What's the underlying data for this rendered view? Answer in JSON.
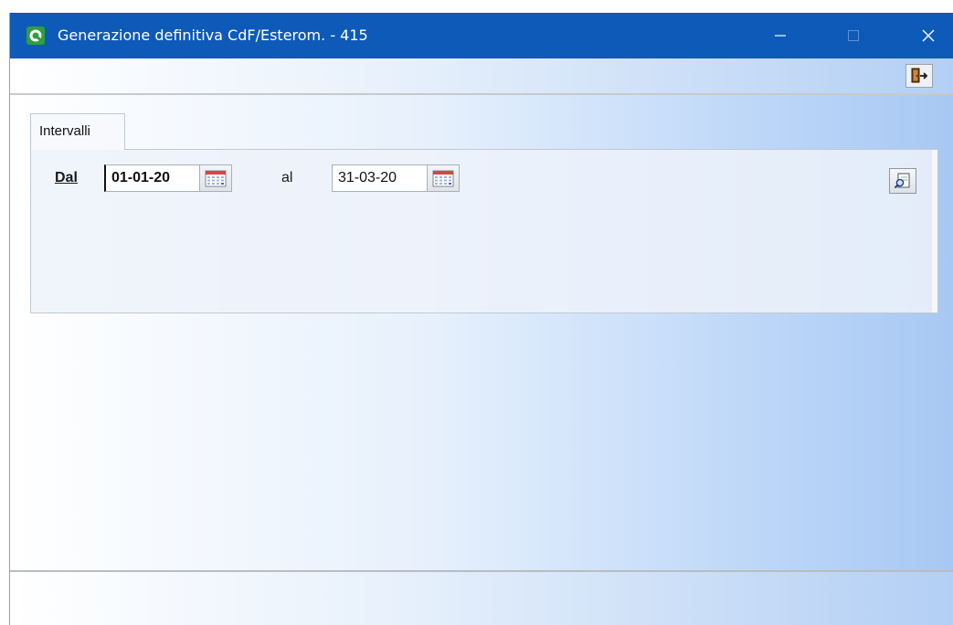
{
  "window": {
    "title": "Generazione definitiva CdF/Esterom. - 415",
    "app_icon": "app-logo-icon",
    "controls": {
      "minimize": "—",
      "maximize": "☐",
      "close": "✕"
    }
  },
  "toolbar": {
    "exit_icon": "exit-door-icon"
  },
  "tabs": [
    {
      "label": "Intervalli",
      "active": true
    }
  ],
  "form": {
    "from_label": "Dal",
    "from_value": "01-01-20",
    "to_label": "al",
    "to_value": "31-03-20",
    "calendar_icon": "calendar-icon",
    "search_icon": "search-document-icon"
  },
  "colors": {
    "titlebar": "#0e5ab8",
    "gradient_end": "#a7c8f4"
  }
}
